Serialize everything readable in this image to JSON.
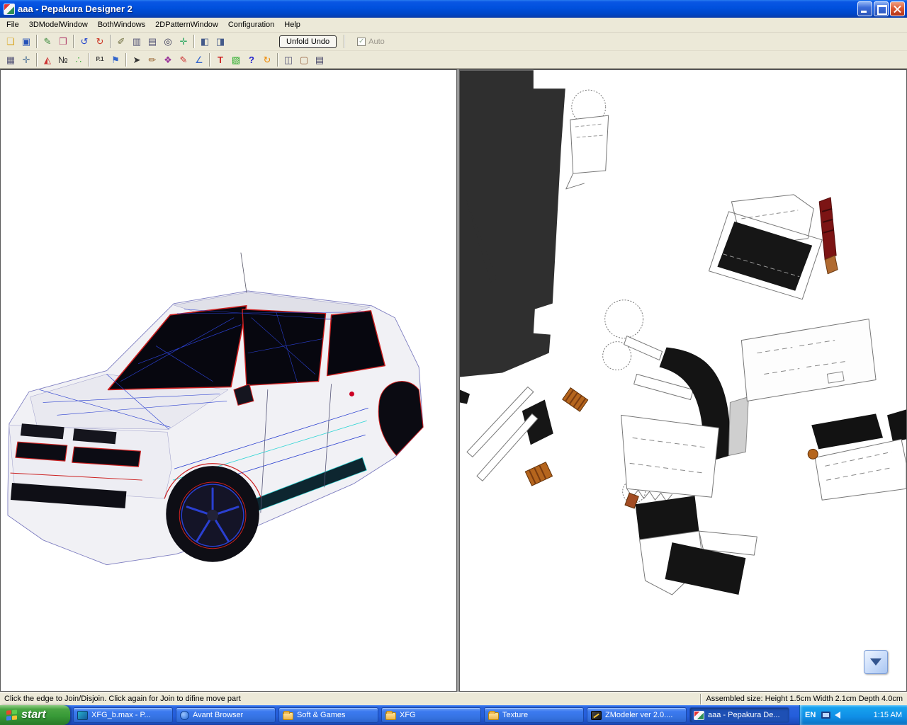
{
  "colors": {
    "titlebar_blue": "#0a57e4",
    "taskbar_blue": "#245edb",
    "tray_blue": "#0f8ee6",
    "start_green": "#379a37",
    "close_red": "#d4502e",
    "edge_highlight_red": "#cc2020",
    "wireframe_blue": "#2a3fd0",
    "wireframe_cyan": "#2fd5d5"
  },
  "window": {
    "title": "aaa - Pepakura Designer 2"
  },
  "menu": {
    "items": [
      "File",
      "3DModelWindow",
      "BothWindows",
      "2DPatternWindow",
      "Configuration",
      "Help"
    ]
  },
  "toolbar_top": {
    "icons": [
      {
        "name": "open-folder-icon",
        "glyph": "❏"
      },
      {
        "name": "save-icon",
        "glyph": "▣"
      },
      {
        "name": "texture-paint-icon",
        "glyph": "✎"
      },
      {
        "name": "texture-view-icon",
        "glyph": "❒"
      },
      {
        "name": "rotate-left-icon",
        "glyph": "↺"
      },
      {
        "name": "rotate-right-icon",
        "glyph": "↻"
      },
      {
        "name": "edit-mode-icon",
        "glyph": "✐"
      },
      {
        "name": "layout-columns-icon",
        "glyph": "▥"
      },
      {
        "name": "page-setup-icon",
        "glyph": "▤"
      },
      {
        "name": "zoom-icon",
        "glyph": "◎"
      },
      {
        "name": "fit-view-icon",
        "glyph": "✛"
      },
      {
        "name": "3d-window-icon",
        "glyph": "◧"
      },
      {
        "name": "2d-window-icon",
        "glyph": "◨"
      }
    ],
    "unfold_button": "Unfold Undo",
    "auto_checkbox": "Auto",
    "auto_checked_glyph": "✓"
  },
  "toolbar_tools": {
    "icons": [
      {
        "name": "select-region-icon",
        "glyph": "▦"
      },
      {
        "name": "snap-grid-icon",
        "glyph": "✛"
      },
      {
        "name": "angle-threshold-icon",
        "glyph": "◭"
      },
      {
        "name": "edge-number-icon",
        "glyph": "№"
      },
      {
        "name": "vertex-dots-icon",
        "glyph": "∴"
      },
      {
        "name": "page-number-icon",
        "glyph": "P.1"
      },
      {
        "name": "flag-icon",
        "glyph": "⚑"
      },
      {
        "name": "cursor-icon",
        "glyph": "➤"
      },
      {
        "name": "pen-icon",
        "glyph": "✏"
      },
      {
        "name": "palette-icon",
        "glyph": "❖"
      },
      {
        "name": "crayon-icon",
        "glyph": "✎"
      },
      {
        "name": "ruler-icon",
        "glyph": "∠"
      },
      {
        "name": "text-icon",
        "glyph": "T"
      },
      {
        "name": "image-icon",
        "glyph": "▧"
      },
      {
        "name": "help-pointer-icon",
        "glyph": "?"
      },
      {
        "name": "rotate-part-icon",
        "glyph": "↻"
      },
      {
        "name": "box-icon",
        "glyph": "◫"
      },
      {
        "name": "case-icon",
        "glyph": "▢"
      },
      {
        "name": "print-icon",
        "glyph": "▤"
      }
    ]
  },
  "statusbar": {
    "hint": "Click the edge to Join/Disjoin. Click again for Join to difine move part",
    "assembled_size": "Assembled size: Height 1.5cm Width 2.1cm Depth 4.0cm"
  },
  "taskbar": {
    "start_label": "start",
    "items": [
      {
        "label": "XFG_b.max   - P..."
      },
      {
        "label": "Avant Browser"
      },
      {
        "label": "Soft & Games"
      },
      {
        "label": "XFG"
      },
      {
        "label": "Texture"
      },
      {
        "label": "ZModeler ver 2.0...."
      },
      {
        "label": "aaa - Pepakura De..."
      }
    ],
    "tray": {
      "language": "EN",
      "time": "1:15 AM"
    }
  }
}
